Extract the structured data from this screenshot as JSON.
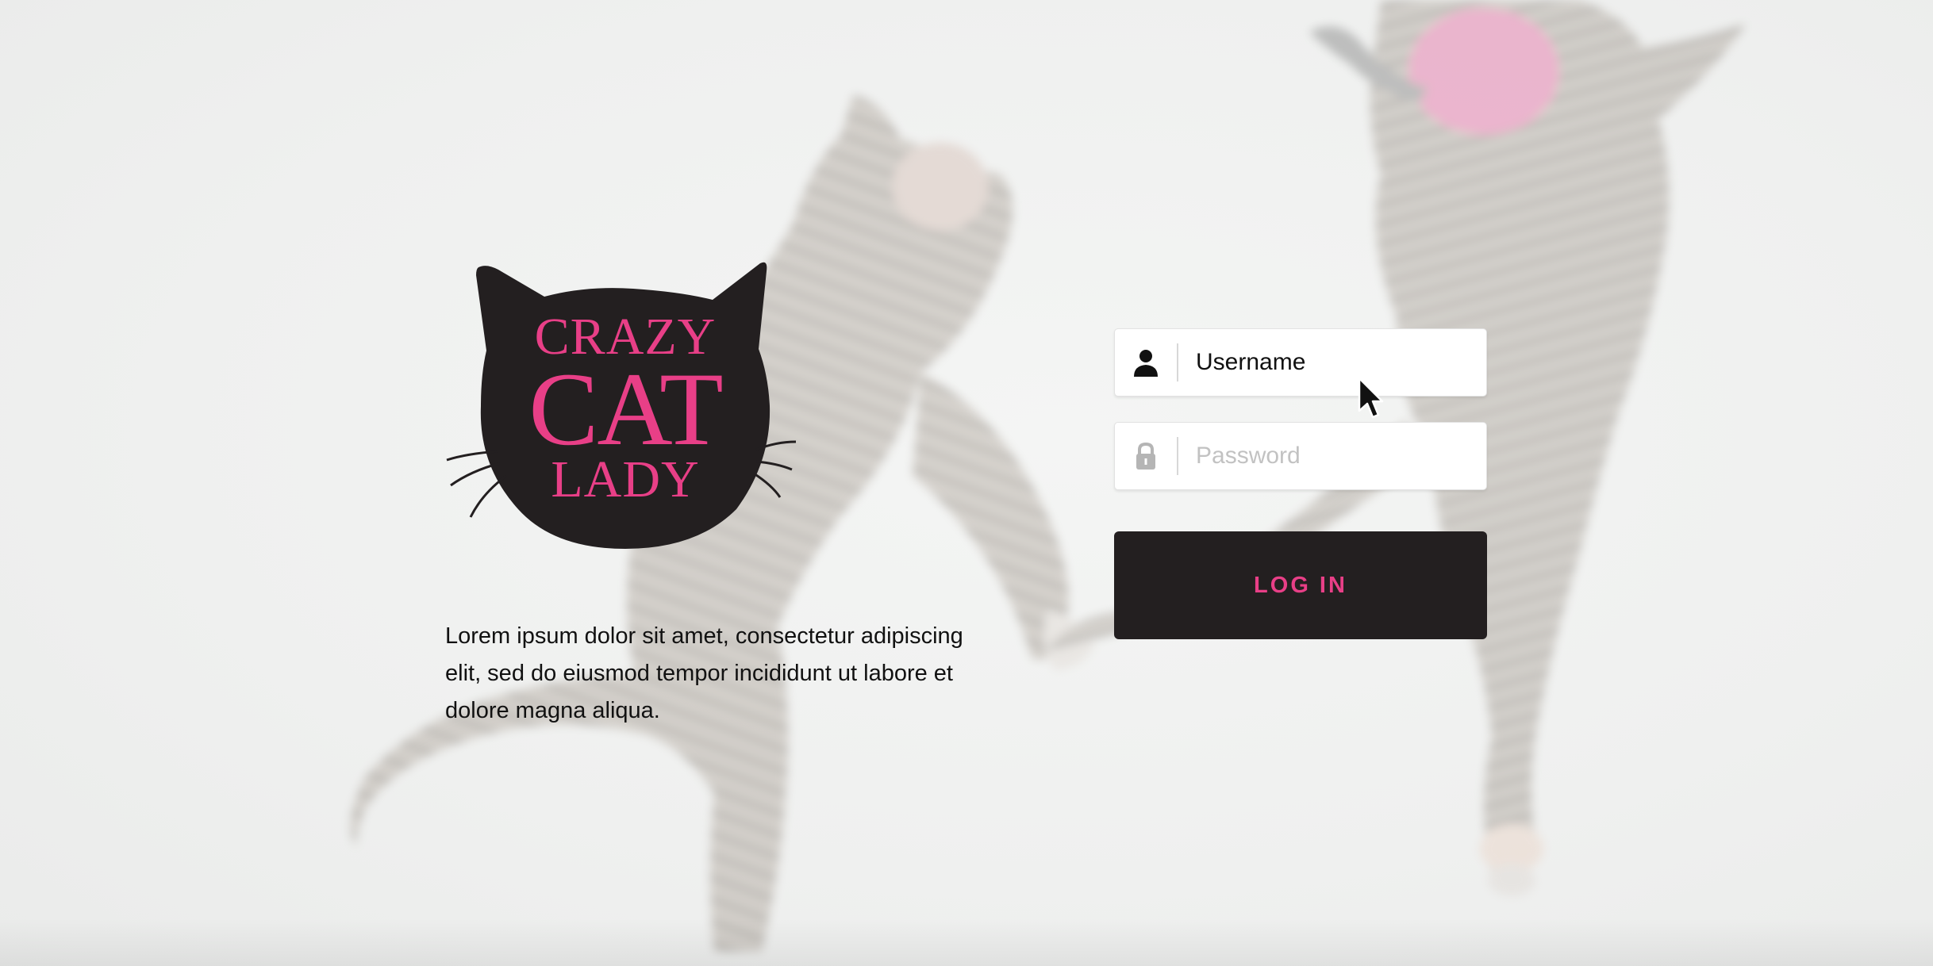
{
  "logo": {
    "line1": "CRAZY",
    "line2": "CAT",
    "line3": "LADY"
  },
  "description": "Lorem ipsum dolor sit amet, consectetur adipiscing elit, sed do eiusmod tempor incididunt ut labore et dolore magna aliqua.",
  "login_form": {
    "username": {
      "value": "Username",
      "icon": "user-icon"
    },
    "password": {
      "placeholder": "Password",
      "icon": "lock-icon"
    },
    "submit_label": "LOG IN"
  },
  "colors": {
    "brand_pink": "#e83f87",
    "dark": "#231f20",
    "background": "#f1f2f1"
  }
}
